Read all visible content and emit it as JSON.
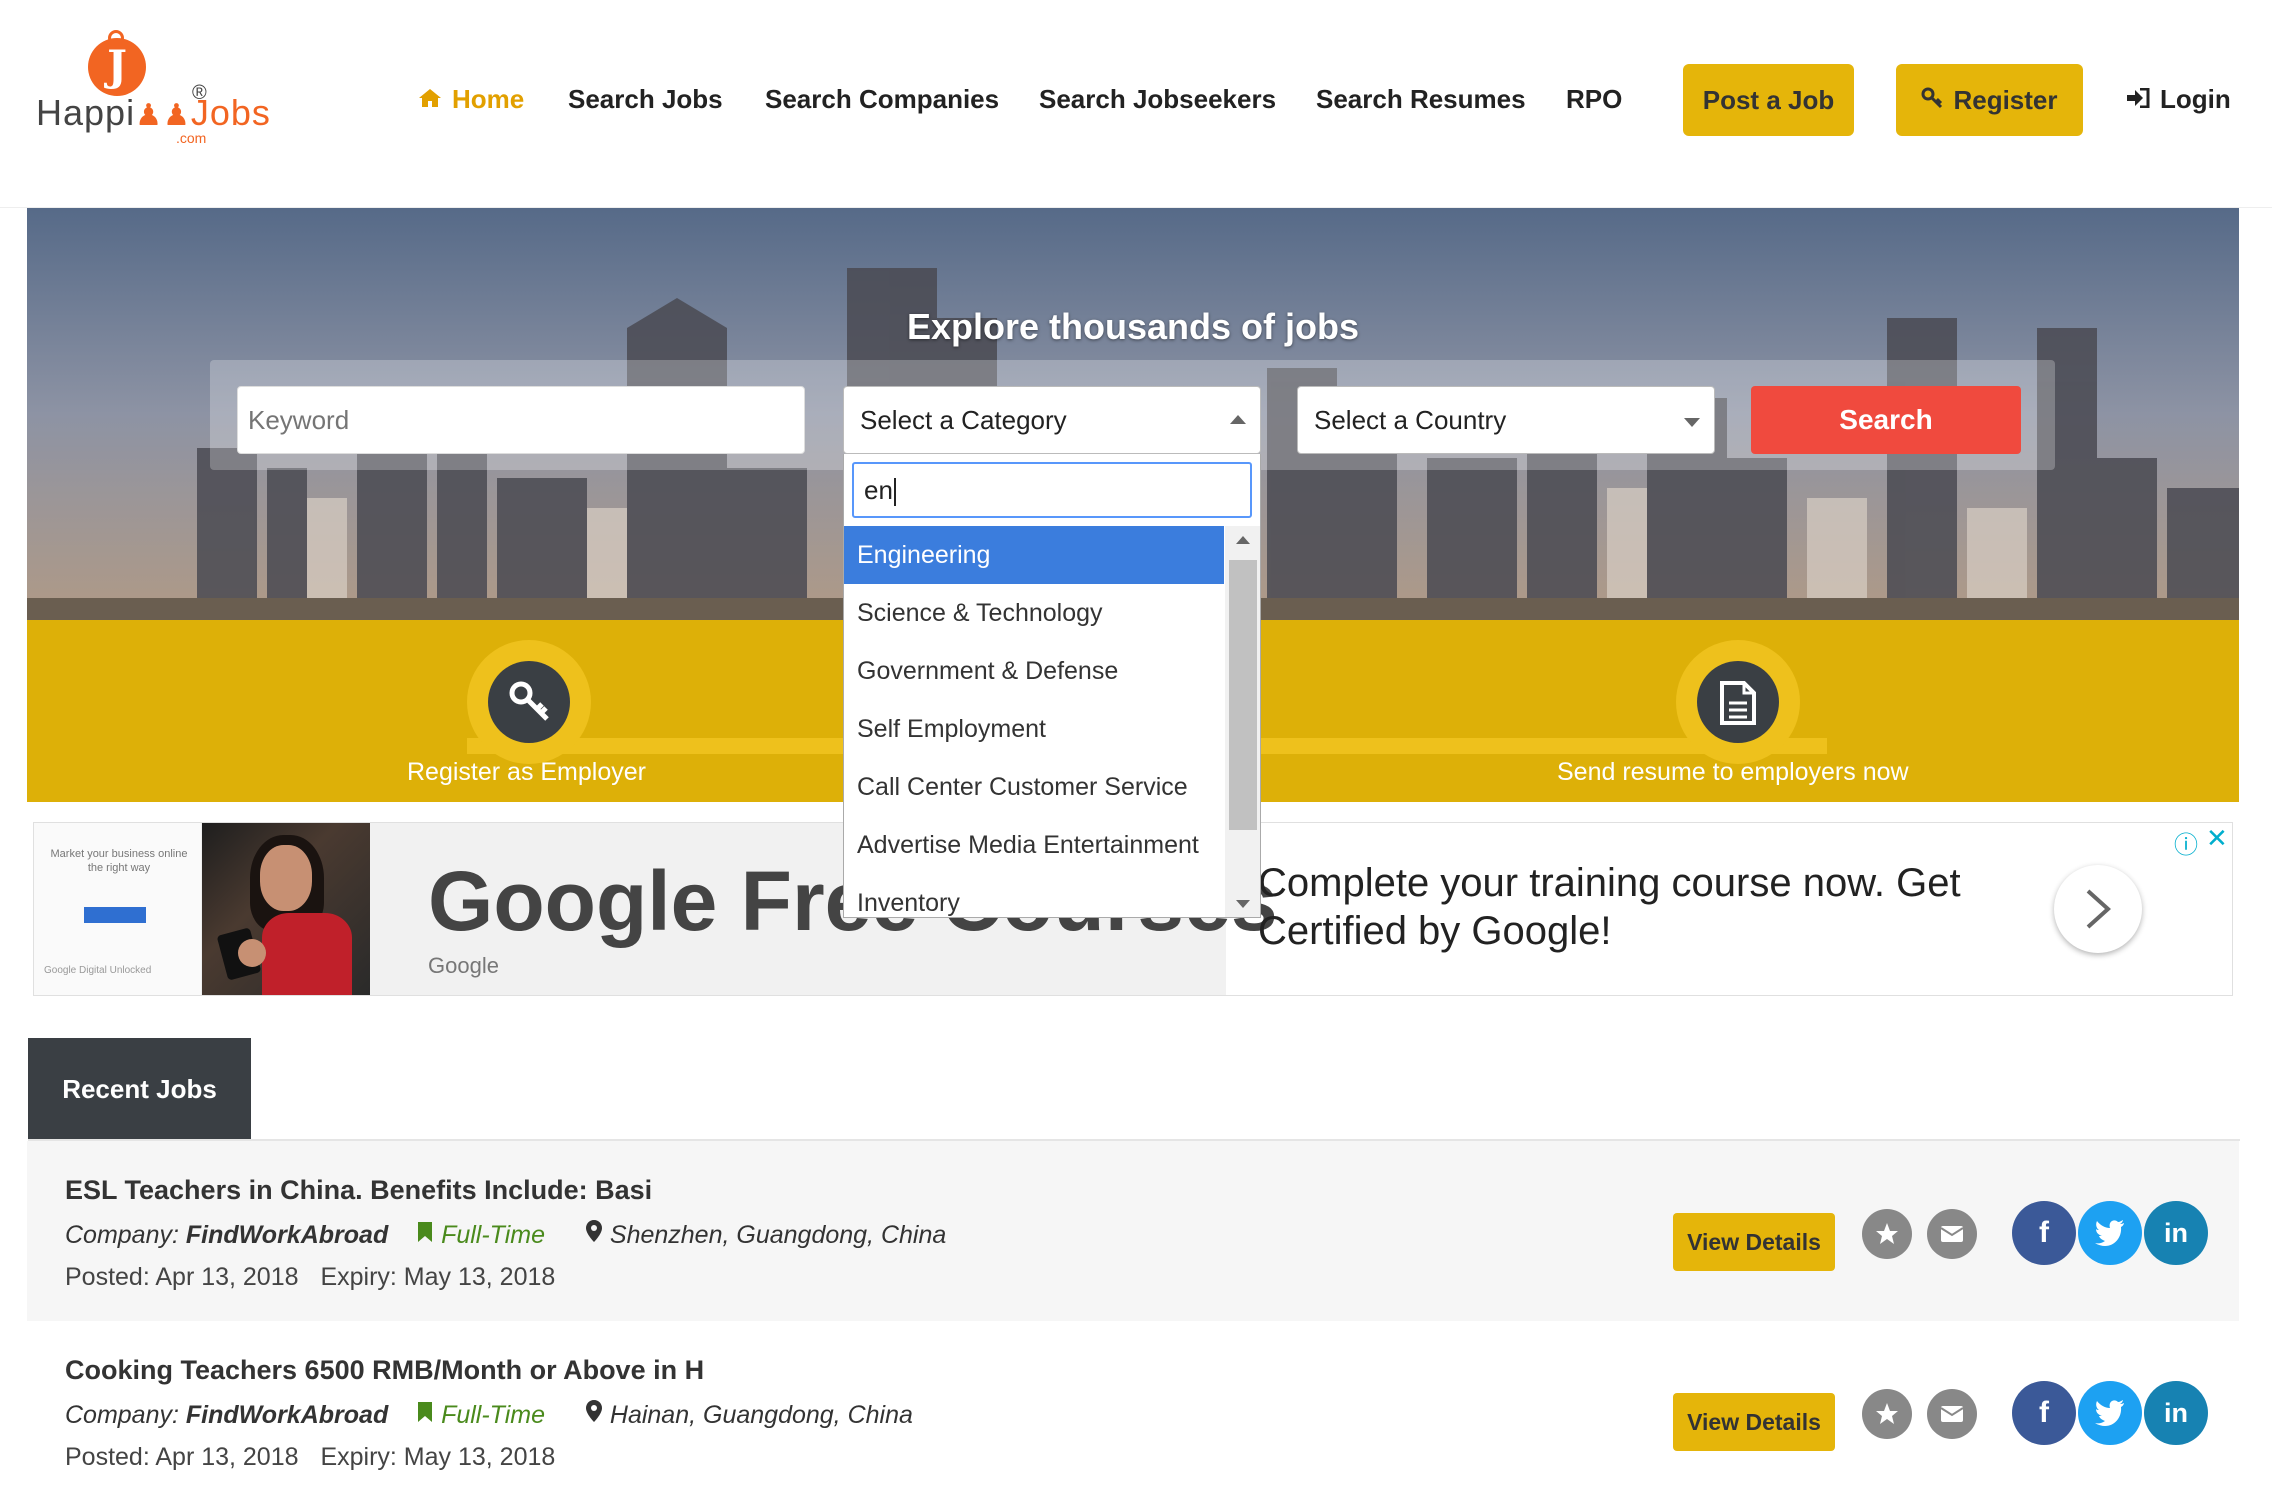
{
  "brand": {
    "logo_word_1": "Happi",
    "logo_word_2": "Jobs",
    "logo_reg": "®",
    "logo_com": ".com"
  },
  "nav": {
    "home": "Home",
    "search_jobs": "Search Jobs",
    "search_companies": "Search Companies",
    "search_jobseekers": "Search Jobseekers",
    "search_resumes": "Search Resumes",
    "rpo": "RPO",
    "post_job": "Post a Job",
    "register": "Register",
    "login": "Login"
  },
  "hero": {
    "title": "Explore thousands of jobs",
    "keyword_placeholder": "Keyword",
    "category_select": "Select a Category",
    "country_select": "Select a Country",
    "search_button": "Search"
  },
  "category_dropdown": {
    "query": "en",
    "options": [
      "Engineering",
      "Science & Technology",
      "Government & Defense",
      "Self Employment",
      "Call Center Customer Service",
      "Advertise Media Entertainment",
      "Inventory"
    ],
    "highlighted_index": 0
  },
  "band": {
    "employer_label": "Register as Employer",
    "resume_label": "Send resume to employers now"
  },
  "ad": {
    "thumb_text": "Market your business online the right way",
    "thumb_footer": "Google Digital Unlocked",
    "headline": "Google Free Courses",
    "sponsor": "Google",
    "description": "Complete your training course now. Get Certified by Google!"
  },
  "recent_jobs": {
    "tab_label": "Recent Jobs",
    "company_label": "Company:",
    "posted_label": "Posted:",
    "expiry_label": "Expiry:",
    "view_details": "View Details",
    "jobs": [
      {
        "title": "ESL Teachers in China. Benefits Include: Basi",
        "company": "FindWorkAbroad",
        "type": "Full-Time",
        "location": "Shenzhen, Guangdong, China",
        "posted": "Apr 13, 2018",
        "expiry": "May 13, 2018"
      },
      {
        "title": "Cooking Teachers 6500 RMB/Month or Above in H",
        "company": "FindWorkAbroad",
        "type": "Full-Time",
        "location": "Hainan, Guangdong, China",
        "posted": "Apr 13, 2018",
        "expiry": "May 13, 2018"
      }
    ]
  },
  "colors": {
    "accent_yellow": "#e5b50a",
    "search_red": "#f04a3e",
    "dark": "#3a3f44",
    "highlight_blue": "#3b7ddd"
  }
}
